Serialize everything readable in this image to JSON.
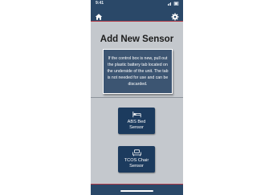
{
  "status_bar": {
    "time": "9:41"
  },
  "nav": {
    "home_icon": "home-icon",
    "settings_icon": "gear-icon"
  },
  "page": {
    "title": "Add New Sensor",
    "info_text": "If the control box is new, pull out the plastic battery tab located on the underside of the unit. The tab is not needed for use and can be discarded."
  },
  "sensors": [
    {
      "icon": "bed-icon",
      "label": "ABS Bed\nSensor"
    },
    {
      "icon": "chair-icon",
      "label": "TCOS Chair\nSensor"
    }
  ],
  "colors": {
    "nav_background": "#2a4868",
    "accent_stripe": "#b23a48",
    "screen_background": "#c4c8cd",
    "info_box": "#3c5572",
    "sensor_button": "#1c3b5e"
  }
}
